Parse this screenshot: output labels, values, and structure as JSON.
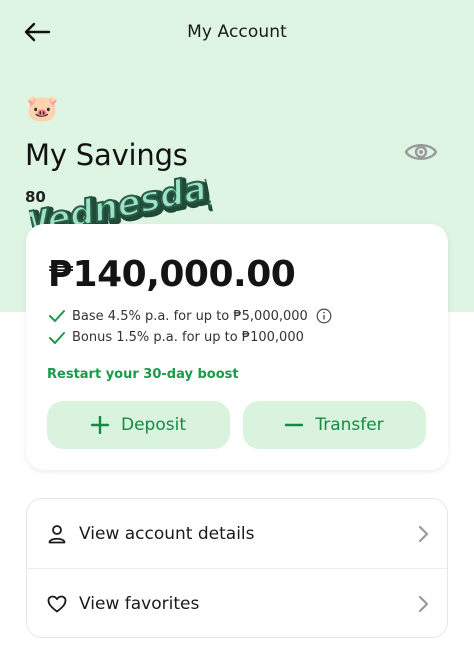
{
  "header": {
    "title": "My Account",
    "back_icon": "arrow-left-icon"
  },
  "savings": {
    "icon": "pig-face-icon",
    "icon_glyph": "🐷",
    "title": "My Savings",
    "account_number_partial": "80",
    "sticker_text": "Wednesday",
    "visibility_icon": "eye-icon"
  },
  "balance_card": {
    "balance": "₱140,000.00",
    "rates": [
      {
        "text": "Base 4.5% p.a. for up to ₱5,000,000"
      },
      {
        "text": "Bonus 1.5% p.a. for up to ₱100,000"
      }
    ],
    "boost_link": "Restart your 30-day boost",
    "deposit_label": "Deposit",
    "transfer_label": "Transfer"
  },
  "menu": {
    "items": [
      {
        "label": "View account details",
        "icon": "person-icon"
      },
      {
        "label": "View favorites",
        "icon": "heart-icon"
      }
    ]
  },
  "colors": {
    "header_bg": "#dff5e3",
    "accent": "#1a9a4a",
    "button_bg": "#daf3de"
  }
}
